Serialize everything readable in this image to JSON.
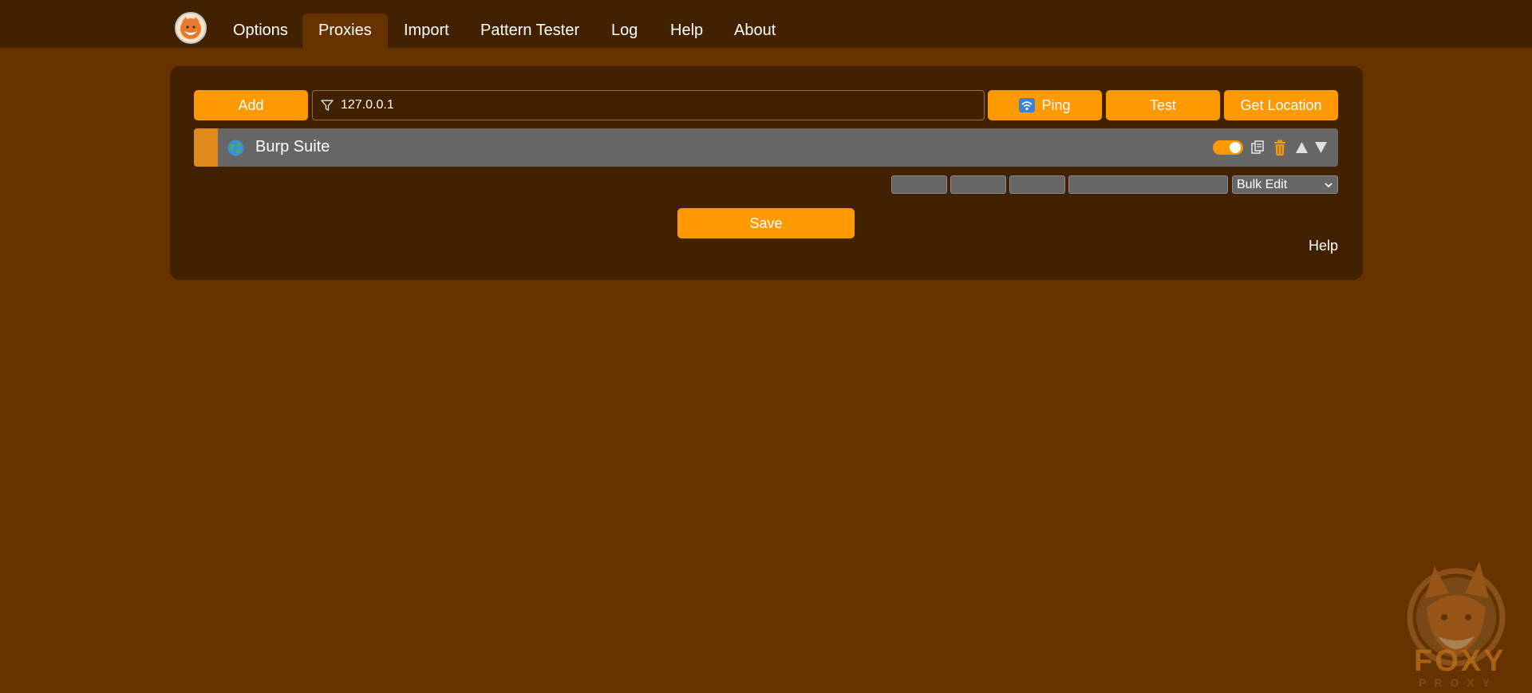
{
  "nav": {
    "tabs": [
      {
        "label": "Options"
      },
      {
        "label": "Proxies"
      },
      {
        "label": "Import"
      },
      {
        "label": "Pattern Tester"
      },
      {
        "label": "Log"
      },
      {
        "label": "Help"
      },
      {
        "label": "About"
      }
    ],
    "active_tab": "Proxies"
  },
  "toolbar": {
    "add_label": "Add",
    "filter_value": "127.0.0.1",
    "ping_label": "Ping",
    "test_label": "Test",
    "get_location_label": "Get Location"
  },
  "proxies": [
    {
      "title": "Burp Suite",
      "color": "#e08a1e",
      "enabled": true
    }
  ],
  "bulk": {
    "select_value": "Bulk Edit"
  },
  "actions": {
    "save_label": "Save",
    "help_label": "Help"
  },
  "watermark": {
    "brand": "FOXY",
    "sub": "PROXY"
  },
  "colors": {
    "background": "#663300",
    "nav_background": "#422100",
    "accent": "#ff9900",
    "row": "#666666"
  }
}
